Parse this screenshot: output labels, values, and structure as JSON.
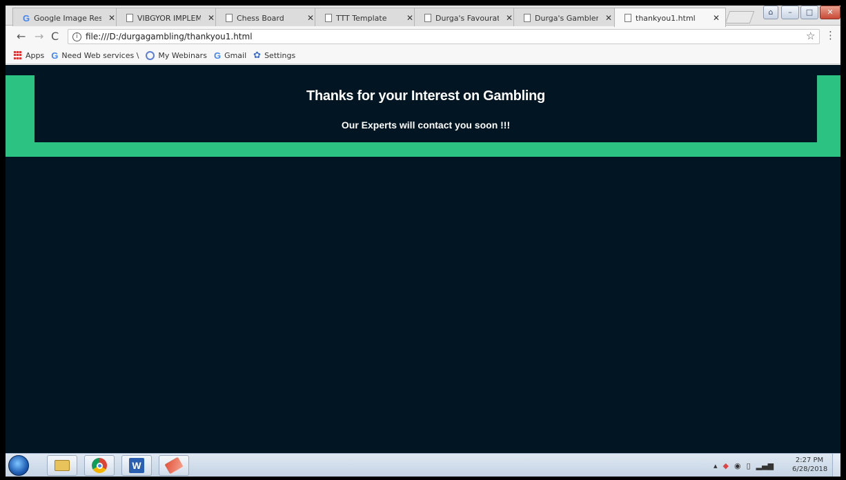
{
  "browser": {
    "tabs": [
      {
        "label": "Google Image Resul",
        "icon": "google-icon",
        "active": false
      },
      {
        "label": "VIBGYOR IMPLEMEN",
        "icon": "page-icon",
        "active": false
      },
      {
        "label": "Chess Board",
        "icon": "page-icon",
        "active": false
      },
      {
        "label": "TTT Template",
        "icon": "page-icon",
        "active": false
      },
      {
        "label": "Durga's Favourate F",
        "icon": "page-icon",
        "active": false
      },
      {
        "label": "Durga's Gamblers G",
        "icon": "page-icon",
        "active": false
      },
      {
        "label": "thankyou1.html",
        "icon": "page-icon",
        "active": true
      }
    ],
    "address": "file:///D:/durgagambling/thankyou1.html",
    "bookmarks": [
      {
        "label": "Apps",
        "icon": "apps-icon"
      },
      {
        "label": "Need Web services \\",
        "icon": "google-icon"
      },
      {
        "label": "My Webinars",
        "icon": "webinar-icon"
      },
      {
        "label": "Gmail",
        "icon": "google-icon"
      },
      {
        "label": "Settings",
        "icon": "gear-icon"
      }
    ]
  },
  "page": {
    "title": "Thanks for your Interest on Gambling",
    "subtitle": "Our Experts will contact you soon !!!",
    "colors": {
      "background": "#011523",
      "accent": "#2bc282"
    }
  },
  "taskbar": {
    "apps": [
      "file-explorer-icon",
      "chrome-icon",
      "word-icon",
      "eraser-icon"
    ],
    "word_letter": "W",
    "clock_time": "2:27 PM",
    "clock_date": "6/28/2018"
  }
}
